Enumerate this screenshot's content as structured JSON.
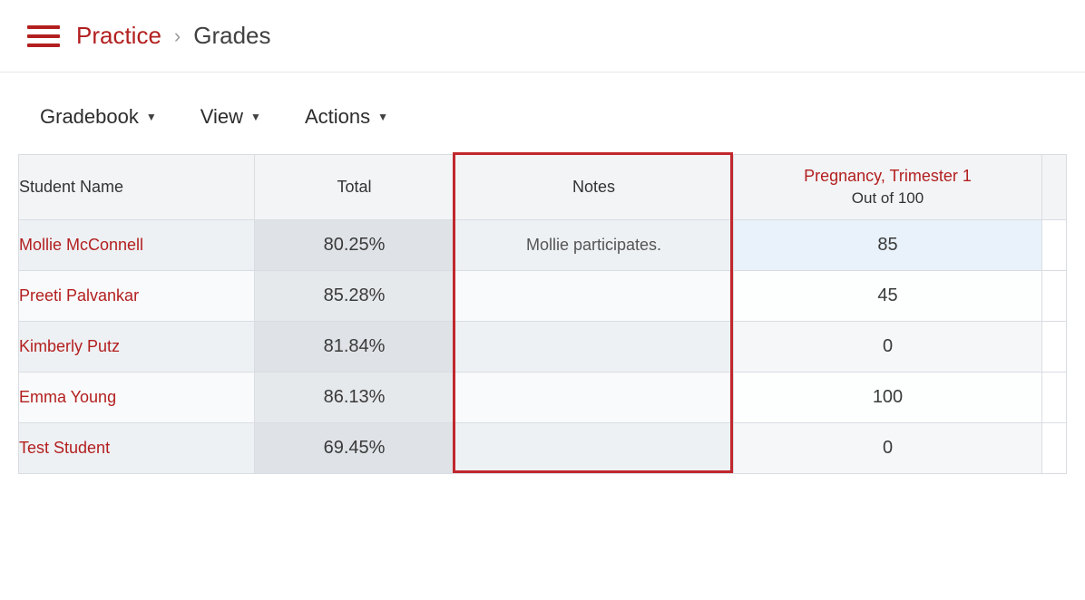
{
  "breadcrumb": {
    "root": "Practice",
    "current": "Grades"
  },
  "toolbar": {
    "gradebook": "Gradebook",
    "view": "View",
    "actions": "Actions"
  },
  "columns": {
    "name": "Student Name",
    "total": "Total",
    "notes": "Notes",
    "assignment_title": "Pregnancy, Trimester 1",
    "assignment_sub": "Out of 100"
  },
  "rows": [
    {
      "name": "Mollie McConnell",
      "total": "80.25%",
      "notes": "Mollie participates.",
      "score": "85",
      "selected": true
    },
    {
      "name": "Preeti Palvankar",
      "total": "85.28%",
      "notes": "",
      "score": "45",
      "selected": false
    },
    {
      "name": "Kimberly Putz",
      "total": "81.84%",
      "notes": "",
      "score": "0",
      "selected": false
    },
    {
      "name": "Emma Young",
      "total": "86.13%",
      "notes": "",
      "score": "100",
      "selected": false
    },
    {
      "name": "Test Student",
      "total": "69.45%",
      "notes": "",
      "score": "0",
      "selected": false
    }
  ]
}
